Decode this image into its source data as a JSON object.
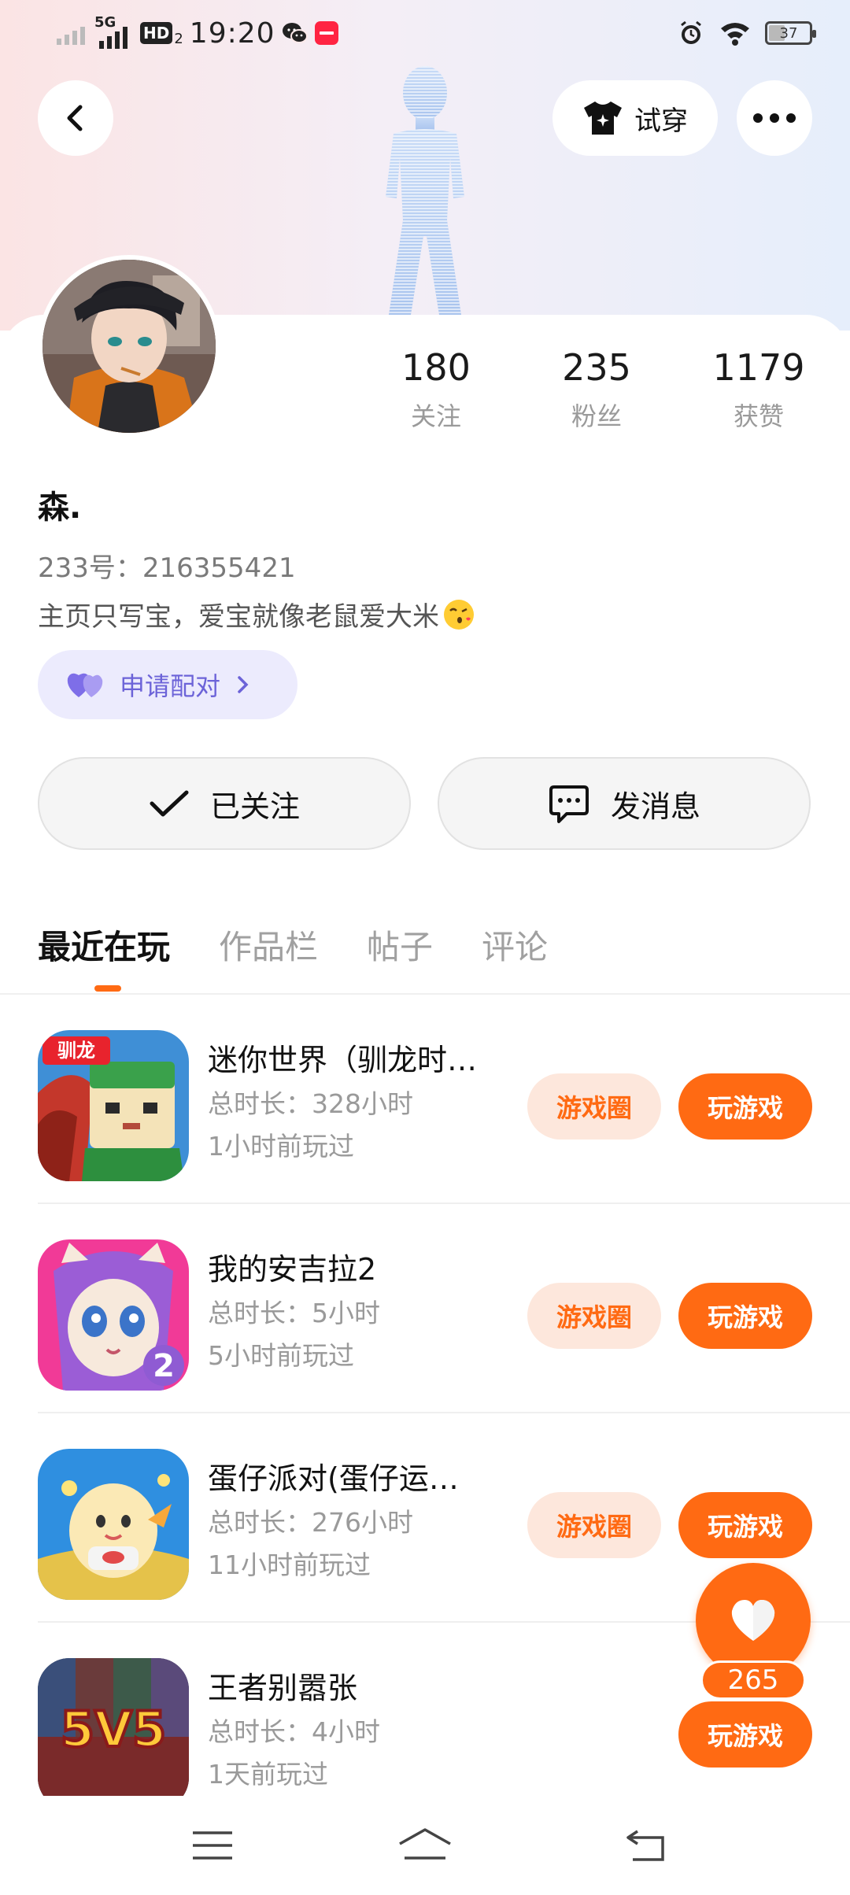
{
  "status_bar": {
    "network": "5G",
    "hd": "HD",
    "time": "19:20",
    "battery": "37"
  },
  "header": {
    "try_on_label": "试穿"
  },
  "profile": {
    "following_count": "180",
    "following_label": "关注",
    "fans_count": "235",
    "fans_label": "粉丝",
    "likes_count": "1179",
    "likes_label": "获赞",
    "username": "森.",
    "uid": "233号：216355421",
    "bio": "主页只写宝，爱宝就像老鼠爱大米",
    "pair_label": "申请配对",
    "followed_label": "已关注",
    "message_label": "发消息"
  },
  "tabs": [
    {
      "label": "最近在玩"
    },
    {
      "label": "作品栏"
    },
    {
      "label": "帖子"
    },
    {
      "label": "评论"
    }
  ],
  "games": [
    {
      "name": "迷你世界（驯龙时…",
      "duration": "总时长：328小时",
      "last_played": "1小时前玩过",
      "circle_label": "游戏圈",
      "play_label": "玩游戏"
    },
    {
      "name": "我的安吉拉2",
      "duration": "总时长：5小时",
      "last_played": "5小时前玩过",
      "circle_label": "游戏圈",
      "play_label": "玩游戏"
    },
    {
      "name": "蛋仔派对(蛋仔运…",
      "duration": "总时长：276小时",
      "last_played": "11小时前玩过",
      "circle_label": "游戏圈",
      "play_label": "玩游戏"
    },
    {
      "name": "王者别嚣张",
      "duration": "总时长：4小时",
      "last_played": "1天前玩过",
      "play_label": "玩游戏"
    }
  ],
  "game_icon_text": {
    "g1_badge": "驯龙",
    "g2_badge": "2",
    "g4_badge": "5V5"
  },
  "like_fab": {
    "count": "265"
  },
  "colors": {
    "accent": "#ff6a13",
    "pair_purple": "#6c63d8"
  }
}
